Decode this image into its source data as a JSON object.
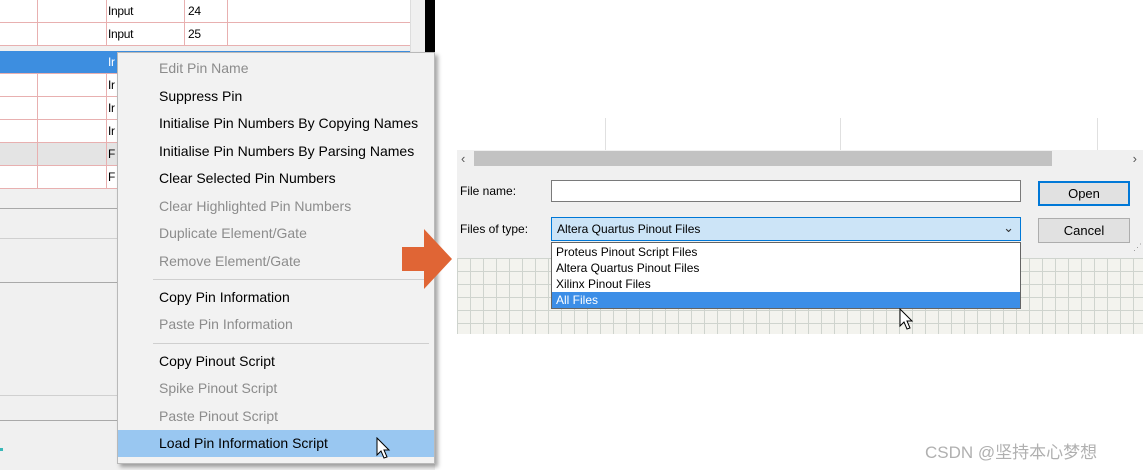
{
  "pin_table": {
    "rows": [
      {
        "type": "Input",
        "number": "24"
      },
      {
        "type": "Input",
        "number": "25"
      },
      {
        "type": "Ir",
        "number": ""
      },
      {
        "type": "Ir",
        "number": ""
      },
      {
        "type": "Ir",
        "number": ""
      },
      {
        "type": "Ir",
        "number": ""
      },
      {
        "type": "F",
        "number": ""
      },
      {
        "type": "F",
        "number": ""
      }
    ]
  },
  "context_menu": {
    "items": [
      {
        "label": "Edit Pin Name",
        "enabled": false
      },
      {
        "label": "Suppress Pin",
        "enabled": true
      },
      {
        "label": "Initialise Pin Numbers By Copying Names",
        "enabled": true
      },
      {
        "label": "Initialise Pin Numbers By Parsing Names",
        "enabled": true
      },
      {
        "label": "Clear Selected Pin Numbers",
        "enabled": true
      },
      {
        "label": "Clear Highlighted Pin Numbers",
        "enabled": false
      },
      {
        "label": "Duplicate Element/Gate",
        "enabled": false
      },
      {
        "label": "Remove Element/Gate",
        "enabled": false
      },
      {
        "label": "Copy Pin Information",
        "enabled": true
      },
      {
        "label": "Paste Pin Information",
        "enabled": false
      },
      {
        "label": "Copy Pinout Script",
        "enabled": true
      },
      {
        "label": "Spike Pinout Script",
        "enabled": false
      },
      {
        "label": "Paste Pinout Script",
        "enabled": false
      },
      {
        "label": "Load Pin Information Script",
        "enabled": true,
        "highlighted": true
      }
    ]
  },
  "file_dialog": {
    "file_name_label": "File name:",
    "file_name_value": "",
    "files_of_type_label": "Files of type:",
    "selected_type": "Altera Quartus Pinout Files",
    "open_label": "Open",
    "cancel_label": "Cancel",
    "type_options": [
      {
        "label": "Proteus Pinout Script Files",
        "selected": false
      },
      {
        "label": "Altera Quartus Pinout Files",
        "selected": false
      },
      {
        "label": "Xilinx Pinout Files",
        "selected": false
      },
      {
        "label": "All Files",
        "selected": true
      }
    ]
  },
  "annotations": {
    "arrow_color": "#e06535"
  },
  "watermark": "CSDN @坚持本心梦想",
  "colors": {
    "selection_blue": "#3d8ee0",
    "menu_highlight": "#99c7f1",
    "focus_blue": "#0078d7"
  }
}
